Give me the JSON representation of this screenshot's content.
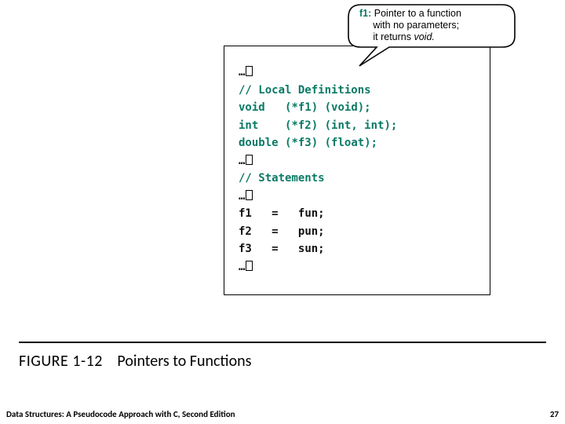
{
  "callout": {
    "label": "f1:",
    "text_line1": "Pointer to a function",
    "text_line2": "with no parameters;",
    "text_line3": "it returns ",
    "void_word": "void."
  },
  "code": {
    "ellipsis": "…",
    "comment_defs": "// Local Definitions",
    "line_void_decl_type": "void",
    "line_void_decl_name": "(*f1)",
    "line_void_decl_params": "(void);",
    "line_int_decl_type": "int",
    "line_int_decl_name": "(*f2)",
    "line_int_decl_params": "(int, int);",
    "line_dbl_decl_type": "double",
    "line_dbl_decl_name": "(*f3)",
    "line_dbl_decl_params": "(float);",
    "comment_stmts": "// Statements",
    "assign1_lhs": "f1",
    "assign1_rhs": "fun;",
    "assign2_lhs": "f2",
    "assign2_rhs": "pun;",
    "assign3_lhs": "f3",
    "assign3_rhs": "sun;",
    "eq": "="
  },
  "figure": {
    "number": "FIGURE 1-12",
    "title": "Pointers to Functions"
  },
  "footer": {
    "left": "Data Structures: A Pseudocode Approach with C, Second Edition",
    "page": "27"
  }
}
